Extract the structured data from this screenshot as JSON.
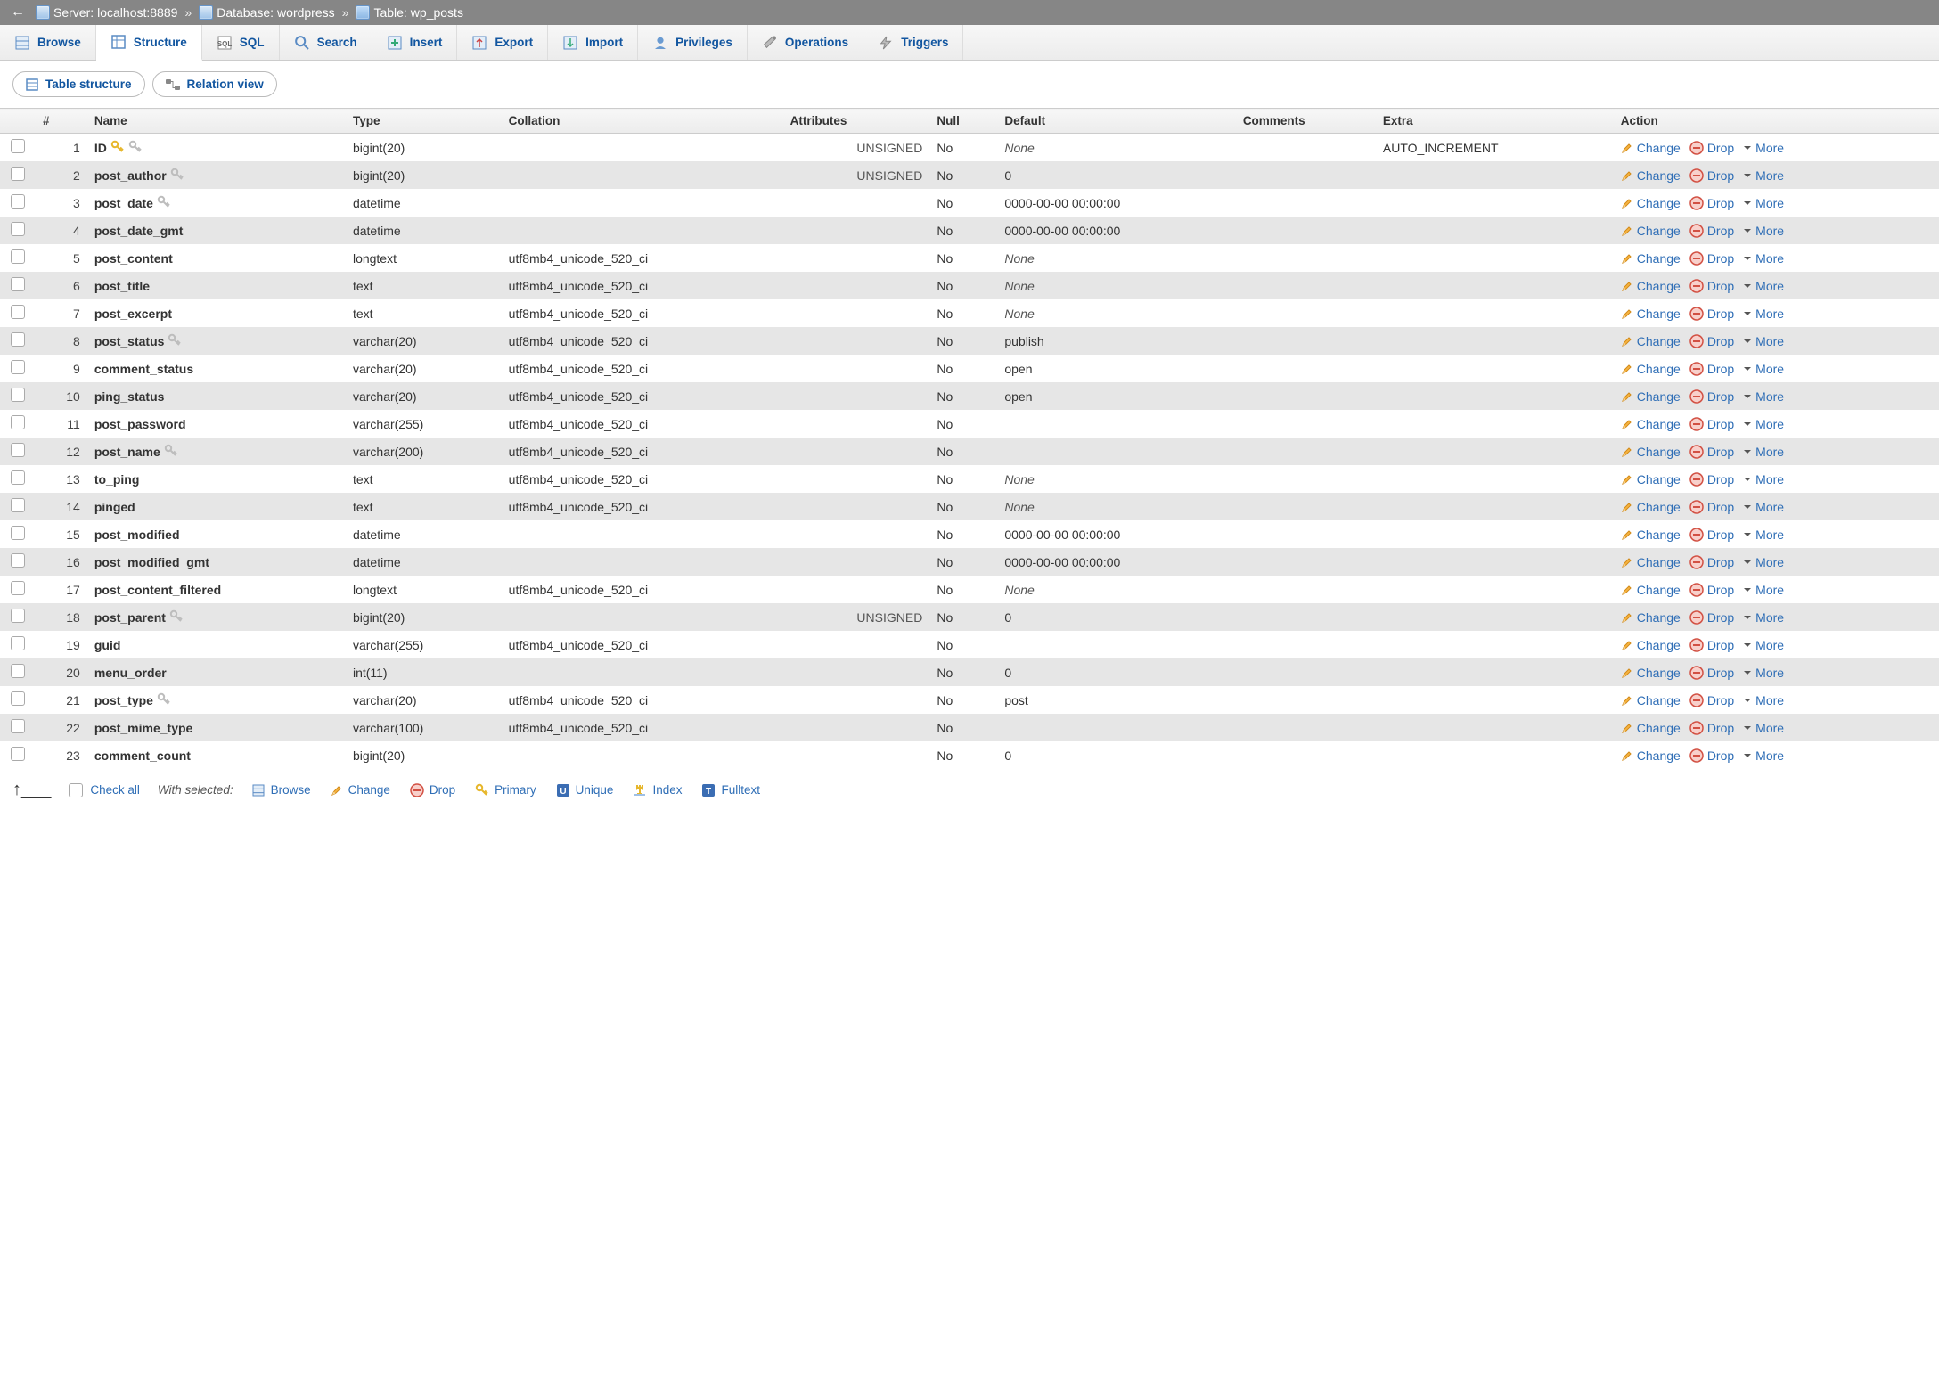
{
  "breadcrumb": {
    "server_label": "Server:",
    "server_value": "localhost:8889",
    "database_label": "Database:",
    "database_value": "wordpress",
    "table_label": "Table:",
    "table_value": "wp_posts"
  },
  "tabs": [
    {
      "label": "Browse",
      "icon": "browse"
    },
    {
      "label": "Structure",
      "icon": "structure",
      "active": true
    },
    {
      "label": "SQL",
      "icon": "sql"
    },
    {
      "label": "Search",
      "icon": "search"
    },
    {
      "label": "Insert",
      "icon": "insert"
    },
    {
      "label": "Export",
      "icon": "export"
    },
    {
      "label": "Import",
      "icon": "import"
    },
    {
      "label": "Privileges",
      "icon": "privileges"
    },
    {
      "label": "Operations",
      "icon": "operations"
    },
    {
      "label": "Triggers",
      "icon": "triggers"
    }
  ],
  "subtabs": {
    "table_structure": "Table structure",
    "relation_view": "Relation view"
  },
  "headers": {
    "num": "#",
    "name": "Name",
    "type": "Type",
    "collation": "Collation",
    "attributes": "Attributes",
    "null": "Null",
    "default": "Default",
    "comments": "Comments",
    "extra": "Extra",
    "action": "Action"
  },
  "actions": {
    "change": "Change",
    "drop": "Drop",
    "more": "More"
  },
  "columns": [
    {
      "num": 1,
      "name": "ID",
      "type": "bigint(20)",
      "collation": "",
      "attr": "UNSIGNED",
      "null": "No",
      "default": "None",
      "default_italic": true,
      "comments": "",
      "extra": "AUTO_INCREMENT",
      "primary": true,
      "index": true
    },
    {
      "num": 2,
      "name": "post_author",
      "type": "bigint(20)",
      "collation": "",
      "attr": "UNSIGNED",
      "null": "No",
      "default": "0",
      "default_italic": false,
      "comments": "",
      "extra": "",
      "index": true
    },
    {
      "num": 3,
      "name": "post_date",
      "type": "datetime",
      "collation": "",
      "attr": "",
      "null": "No",
      "default": "0000-00-00 00:00:00",
      "default_italic": false,
      "comments": "",
      "extra": "",
      "index": true
    },
    {
      "num": 4,
      "name": "post_date_gmt",
      "type": "datetime",
      "collation": "",
      "attr": "",
      "null": "No",
      "default": "0000-00-00 00:00:00",
      "default_italic": false,
      "comments": "",
      "extra": ""
    },
    {
      "num": 5,
      "name": "post_content",
      "type": "longtext",
      "collation": "utf8mb4_unicode_520_ci",
      "attr": "",
      "null": "No",
      "default": "None",
      "default_italic": true,
      "comments": "",
      "extra": ""
    },
    {
      "num": 6,
      "name": "post_title",
      "type": "text",
      "collation": "utf8mb4_unicode_520_ci",
      "attr": "",
      "null": "No",
      "default": "None",
      "default_italic": true,
      "comments": "",
      "extra": ""
    },
    {
      "num": 7,
      "name": "post_excerpt",
      "type": "text",
      "collation": "utf8mb4_unicode_520_ci",
      "attr": "",
      "null": "No",
      "default": "None",
      "default_italic": true,
      "comments": "",
      "extra": ""
    },
    {
      "num": 8,
      "name": "post_status",
      "type": "varchar(20)",
      "collation": "utf8mb4_unicode_520_ci",
      "attr": "",
      "null": "No",
      "default": "publish",
      "default_italic": false,
      "comments": "",
      "extra": "",
      "index": true
    },
    {
      "num": 9,
      "name": "comment_status",
      "type": "varchar(20)",
      "collation": "utf8mb4_unicode_520_ci",
      "attr": "",
      "null": "No",
      "default": "open",
      "default_italic": false,
      "comments": "",
      "extra": ""
    },
    {
      "num": 10,
      "name": "ping_status",
      "type": "varchar(20)",
      "collation": "utf8mb4_unicode_520_ci",
      "attr": "",
      "null": "No",
      "default": "open",
      "default_italic": false,
      "comments": "",
      "extra": ""
    },
    {
      "num": 11,
      "name": "post_password",
      "type": "varchar(255)",
      "collation": "utf8mb4_unicode_520_ci",
      "attr": "",
      "null": "No",
      "default": "",
      "default_italic": false,
      "comments": "",
      "extra": ""
    },
    {
      "num": 12,
      "name": "post_name",
      "type": "varchar(200)",
      "collation": "utf8mb4_unicode_520_ci",
      "attr": "",
      "null": "No",
      "default": "",
      "default_italic": false,
      "comments": "",
      "extra": "",
      "index": true
    },
    {
      "num": 13,
      "name": "to_ping",
      "type": "text",
      "collation": "utf8mb4_unicode_520_ci",
      "attr": "",
      "null": "No",
      "default": "None",
      "default_italic": true,
      "comments": "",
      "extra": ""
    },
    {
      "num": 14,
      "name": "pinged",
      "type": "text",
      "collation": "utf8mb4_unicode_520_ci",
      "attr": "",
      "null": "No",
      "default": "None",
      "default_italic": true,
      "comments": "",
      "extra": ""
    },
    {
      "num": 15,
      "name": "post_modified",
      "type": "datetime",
      "collation": "",
      "attr": "",
      "null": "No",
      "default": "0000-00-00 00:00:00",
      "default_italic": false,
      "comments": "",
      "extra": ""
    },
    {
      "num": 16,
      "name": "post_modified_gmt",
      "type": "datetime",
      "collation": "",
      "attr": "",
      "null": "No",
      "default": "0000-00-00 00:00:00",
      "default_italic": false,
      "comments": "",
      "extra": ""
    },
    {
      "num": 17,
      "name": "post_content_filtered",
      "type": "longtext",
      "collation": "utf8mb4_unicode_520_ci",
      "attr": "",
      "null": "No",
      "default": "None",
      "default_italic": true,
      "comments": "",
      "extra": ""
    },
    {
      "num": 18,
      "name": "post_parent",
      "type": "bigint(20)",
      "collation": "",
      "attr": "UNSIGNED",
      "null": "No",
      "default": "0",
      "default_italic": false,
      "comments": "",
      "extra": "",
      "index": true
    },
    {
      "num": 19,
      "name": "guid",
      "type": "varchar(255)",
      "collation": "utf8mb4_unicode_520_ci",
      "attr": "",
      "null": "No",
      "default": "",
      "default_italic": false,
      "comments": "",
      "extra": ""
    },
    {
      "num": 20,
      "name": "menu_order",
      "type": "int(11)",
      "collation": "",
      "attr": "",
      "null": "No",
      "default": "0",
      "default_italic": false,
      "comments": "",
      "extra": ""
    },
    {
      "num": 21,
      "name": "post_type",
      "type": "varchar(20)",
      "collation": "utf8mb4_unicode_520_ci",
      "attr": "",
      "null": "No",
      "default": "post",
      "default_italic": false,
      "comments": "",
      "extra": "",
      "index": true
    },
    {
      "num": 22,
      "name": "post_mime_type",
      "type": "varchar(100)",
      "collation": "utf8mb4_unicode_520_ci",
      "attr": "",
      "null": "No",
      "default": "",
      "default_italic": false,
      "comments": "",
      "extra": ""
    },
    {
      "num": 23,
      "name": "comment_count",
      "type": "bigint(20)",
      "collation": "",
      "attr": "",
      "null": "No",
      "default": "0",
      "default_italic": false,
      "comments": "",
      "extra": ""
    }
  ],
  "footer": {
    "check_all": "Check all",
    "with_selected": "With selected:",
    "buttons": [
      {
        "label": "Browse",
        "icon": "browse"
      },
      {
        "label": "Change",
        "icon": "pencil"
      },
      {
        "label": "Drop",
        "icon": "drop"
      },
      {
        "label": "Primary",
        "icon": "primary"
      },
      {
        "label": "Unique",
        "icon": "unique"
      },
      {
        "label": "Index",
        "icon": "index"
      },
      {
        "label": "Fulltext",
        "icon": "fulltext"
      }
    ]
  }
}
